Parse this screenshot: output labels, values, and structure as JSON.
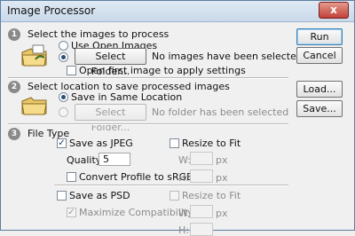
{
  "window": {
    "title": "Image Processor",
    "close_glyph": "x"
  },
  "section1": {
    "step": "1",
    "heading": "Select the images to process",
    "use_open_images": "Use Open Images",
    "select_folder": "Select Folder...",
    "status": "No images have been selected",
    "open_first": "Open first image to apply settings"
  },
  "section2": {
    "step": "2",
    "heading": "Select location to save processed images",
    "save_same": "Save in Same Location",
    "select_folder": "Select Folder...",
    "status": "No folder has been selected"
  },
  "section3": {
    "step": "3",
    "heading": "File Type",
    "save_jpeg": "Save as JPEG",
    "resize_to_fit": "Resize to Fit",
    "quality_label": "Quality:",
    "quality_value": "5",
    "w_label": "W:",
    "h_label": "H:",
    "px": "px",
    "convert_srgb": "Convert Profile to sRGB",
    "save_psd": "Save as PSD",
    "resize_to_fit_psd": "Resize to Fit",
    "maximize": "Maximize Compatibility",
    "w_label2": "W:",
    "h_label2": "H:",
    "px2": "px"
  },
  "actions": {
    "run": "Run",
    "cancel": "Cancel",
    "load": "Load...",
    "save": "Save..."
  },
  "icons": {
    "folder": "folder-icon"
  }
}
